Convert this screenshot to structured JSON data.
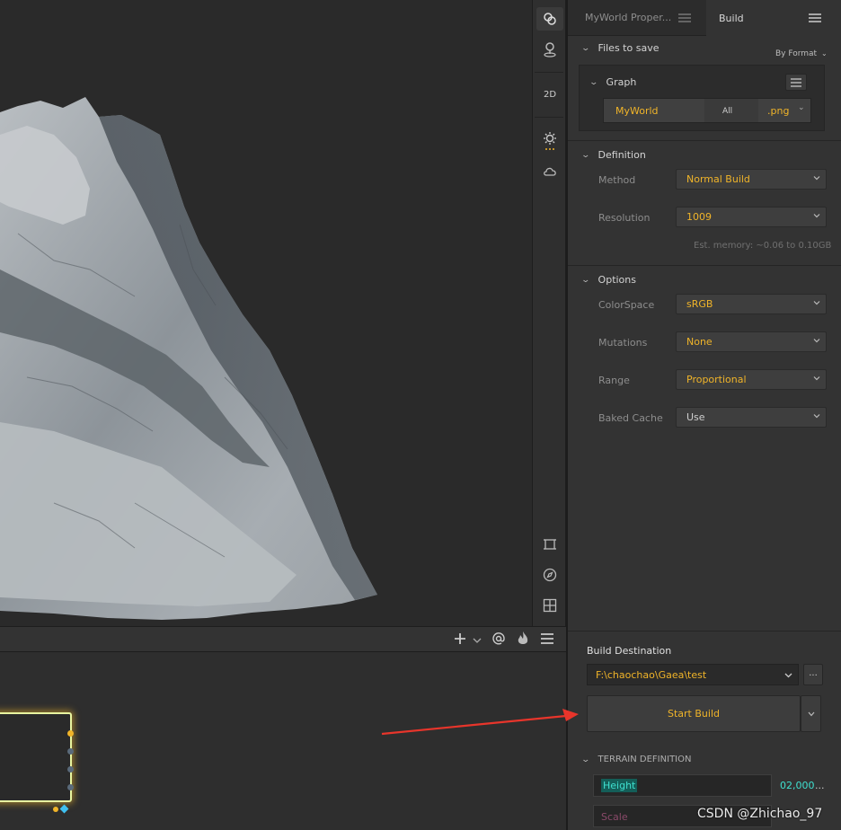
{
  "tabs": {
    "properties_label": "MyWorld Proper...",
    "build_label": "Build"
  },
  "view_toolbar": {
    "mode_2d": "2D"
  },
  "files_to_save": {
    "title": "Files to save",
    "format_label": "By Format",
    "graph_title": "Graph",
    "file_name": "MyWorld",
    "scope": "All",
    "extension": ".png"
  },
  "definition": {
    "title": "Definition",
    "method_label": "Method",
    "method_value": "Normal Build",
    "resolution_label": "Resolution",
    "resolution_value": "1009",
    "memory_note": "Est. memory: ~0.06 to 0.10GB"
  },
  "options": {
    "title": "Options",
    "colorspace_label": "ColorSpace",
    "colorspace_value": "sRGB",
    "mutations_label": "Mutations",
    "mutations_value": "None",
    "range_label": "Range",
    "range_value": "Proportional",
    "baked_cache_label": "Baked Cache",
    "baked_cache_value": "Use"
  },
  "build": {
    "destination_label": "Build Destination",
    "destination_value": "F:\\chaochao\\Gaea\\test",
    "browse_label": "...",
    "start_label": "Start Build"
  },
  "terrain": {
    "title": "TERRAIN DEFINITION",
    "height_label": "Height",
    "height_value": "02,000",
    "height_more": "...",
    "scale_label": "Scale"
  },
  "watermark": "CSDN @Zhichao_97",
  "colors": {
    "accent_orange": "#f0b429",
    "accent_cyan": "#3fe0d0",
    "annotation_red": "#e8352b",
    "node_border": "#e8f5a0"
  }
}
